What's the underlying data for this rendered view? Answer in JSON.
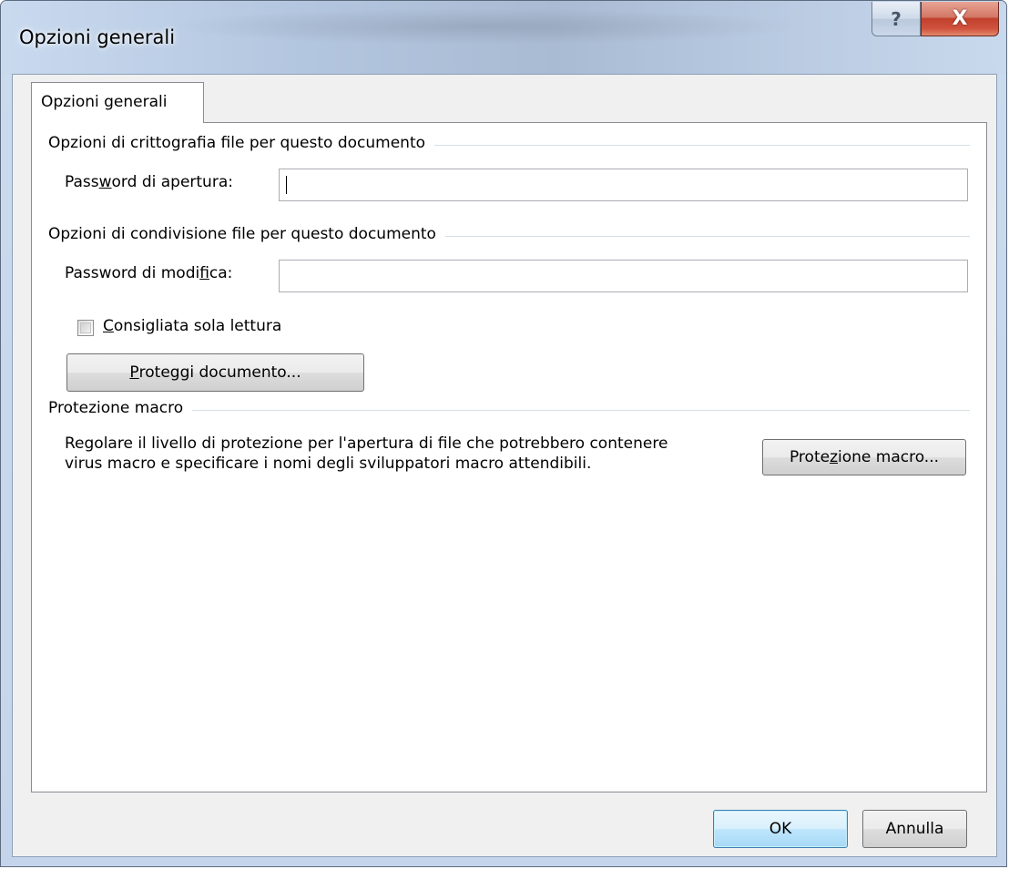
{
  "window": {
    "title": "Opzioni generali",
    "help_label": "?",
    "close_label": "X"
  },
  "tab": {
    "label": "Opzioni generali"
  },
  "encryption": {
    "group_title": "Opzioni di crittografia file per questo documento",
    "open_password_label": {
      "pre": "Pass",
      "ul": "w",
      "post": "ord di apertura:"
    },
    "open_password_value": ""
  },
  "sharing": {
    "group_title": "Opzioni di condivisione file per questo documento",
    "modify_password_label": {
      "pre": "Password di modi",
      "ul": "f",
      "post": "ica:"
    },
    "modify_password_value": "",
    "read_only_label": {
      "pre": "",
      "ul": "C",
      "post": "onsigliata sola lettura"
    },
    "read_only_checked": false,
    "protect_button": {
      "pre": "",
      "ul": "P",
      "post": "roteggi documento..."
    }
  },
  "macro": {
    "group_title": "Protezione macro",
    "description_line1": "Regolare il livello di protezione per l'apertura di file che potrebbero contenere",
    "description_line2": "virus macro e specificare i nomi degli sviluppatori macro attendibili.",
    "macro_button": {
      "pre": "Prote",
      "ul": "z",
      "post": "ione macro..."
    }
  },
  "footer": {
    "ok_label": "OK",
    "cancel_label": "Annulla"
  },
  "colors": {
    "title_bar": "#b9cbe2",
    "close_button": "#c7432f",
    "default_button_border": "#3c7fb1"
  }
}
